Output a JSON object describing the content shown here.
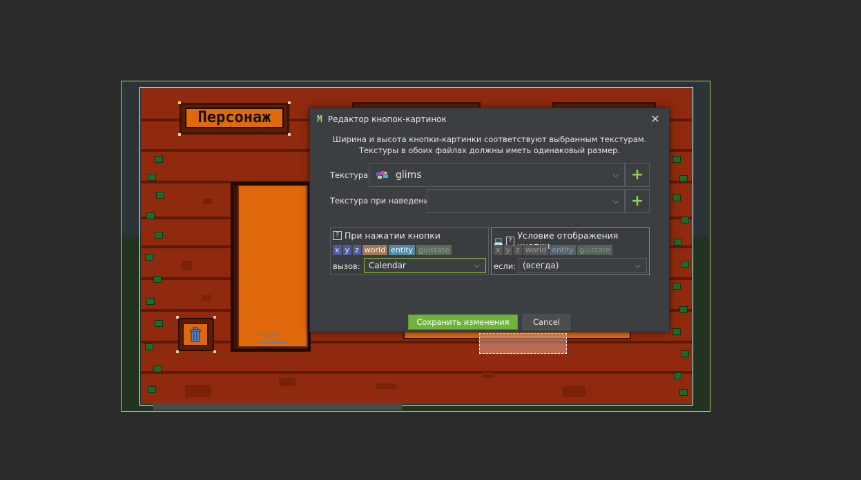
{
  "canvas": {
    "gui_title": "Персонаж",
    "player_label": "Player"
  },
  "dialog": {
    "title": "Редактор кнопок-картинок",
    "close_glyph": "✕",
    "info_line1": "Ширина и высота кнопки-картинки соответствуют выбранным текстурам.",
    "info_line2": "Текстуры в обоих файлах должны иметь одинаковый размер.",
    "texture_label": "Текстура:",
    "texture_value": "glims",
    "hover_texture_label": "Текстура при наведении:",
    "hover_texture_value": "",
    "plus_glyph": "+",
    "on_click": {
      "title": "При нажатии кнопки",
      "chips": [
        "x",
        "y",
        "z",
        "world",
        "entity",
        "guistate"
      ],
      "call_label": "вызов:",
      "call_value": "Calendar"
    },
    "display_condition": {
      "title": "Условие отображения кнопки",
      "chips": [
        "x",
        "y",
        "z",
        "world",
        "entity",
        "guistate"
      ],
      "if_label": "если:",
      "if_value": "(всегда)"
    },
    "save_label": "Сохранить изменения",
    "cancel_label": "Cancel"
  },
  "colors": {
    "accent_green": "#8fd14a",
    "save_button": "#6fb33c",
    "gui_wood": "#8f2a0e",
    "gui_orange": "#e0690c"
  }
}
